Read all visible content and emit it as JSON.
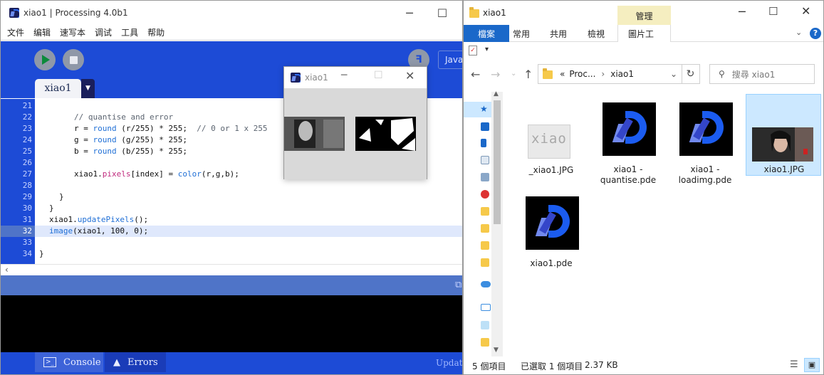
{
  "ide": {
    "title": "xiao1 | Processing 4.0b1",
    "menu": [
      "文件",
      "编辑",
      "速写本",
      "调试",
      "工具",
      "帮助"
    ],
    "mode_label": "Java",
    "mode_icon": "processing-mode-icon",
    "tab_name": "xiao1",
    "tab_menu_glyph": "▼",
    "code_lines": [
      {
        "n": "21",
        "text": ""
      },
      {
        "n": "22",
        "text": "// quantise and error"
      },
      {
        "n": "23",
        "text": "r = round (r/255) * 255;  // 0 or 1 x 255"
      },
      {
        "n": "24",
        "text": "g = round (g/255) * 255;"
      },
      {
        "n": "25",
        "text": "b = round (b/255) * 255;"
      },
      {
        "n": "26",
        "text": ""
      },
      {
        "n": "27",
        "text": "xiao1.pixels[index] = color(r,g,b);"
      },
      {
        "n": "28",
        "text": ""
      },
      {
        "n": "29",
        "text": "}"
      },
      {
        "n": "30",
        "text": "}"
      },
      {
        "n": "31",
        "text": "xiao1.updatePixels();"
      },
      {
        "n": "32",
        "text": "image(xiao1, 100, 0);"
      },
      {
        "n": "33",
        "text": ""
      },
      {
        "n": "34",
        "text": "}"
      }
    ],
    "current_line": "32",
    "console_tab": "Console",
    "errors_tab": "Errors",
    "updates_text": "Updates"
  },
  "sketch": {
    "title": "xiao1"
  },
  "explorer": {
    "title": "xiao1",
    "manage_tab": "管理",
    "ribbon": {
      "file_tab": "檔案",
      "tabs": [
        "常用",
        "共用",
        "檢視"
      ],
      "picture_tools": "圖片工具"
    },
    "address": {
      "prefix": "«",
      "parts": [
        "Proc...",
        "xiao1"
      ]
    },
    "search_placeholder": "搜尋 xiao1",
    "files": [
      {
        "name": "_xiao1.JPG",
        "kind": "jpg-text"
      },
      {
        "name": "xiao1 - quantise.pde",
        "kind": "pde"
      },
      {
        "name": "xiao1 -loadimg.pde",
        "kind": "pde"
      },
      {
        "name": "xiao1.JPG",
        "kind": "jpg-photo",
        "selected": true
      },
      {
        "name": "xiao1.pde",
        "kind": "pde"
      }
    ],
    "status": {
      "count": "5 個項目",
      "selection": "已選取 1 個項目",
      "size": "2.37 KB"
    }
  },
  "colors": {
    "ide_blue": "#1d4bd6",
    "explorer_accent": "#1a68c9",
    "selection": "#cce8ff",
    "manage_tab": "#f5eec0"
  }
}
